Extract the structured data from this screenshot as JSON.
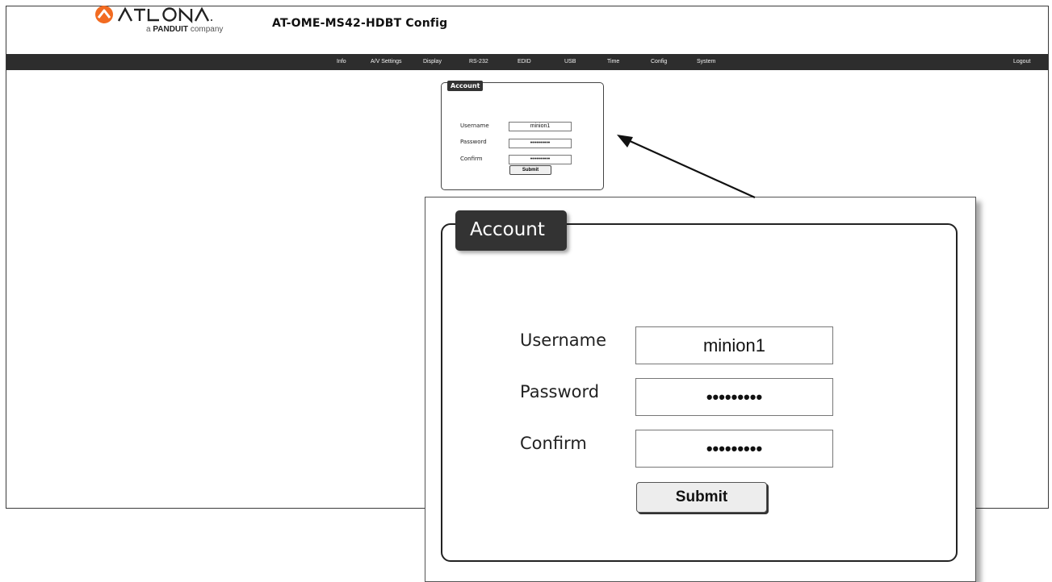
{
  "brand": {
    "name": "ATLONA",
    "tagline_prefix": "a",
    "tagline_brand": "PANDUIT",
    "tagline_suffix": "company",
    "accent_color": "#f26b21"
  },
  "header": {
    "title": "AT-OME-MS42-HDBT  Config"
  },
  "nav": {
    "items": [
      {
        "label": "Info"
      },
      {
        "label": "A/V Settings"
      },
      {
        "label": "Display"
      },
      {
        "label": "RS-232"
      },
      {
        "label": "EDID"
      },
      {
        "label": "USB"
      },
      {
        "label": "Time"
      },
      {
        "label": "Config"
      },
      {
        "label": "System"
      }
    ],
    "logout": "Logout"
  },
  "account": {
    "legend": "Account",
    "username_label": "Username",
    "username_value": "minion1",
    "password_label": "Password",
    "password_value": "••••••••••",
    "confirm_label": "Confirm",
    "confirm_value": "••••••••••",
    "submit_label": "Submit"
  },
  "zoom": {
    "legend": "Account",
    "username_label": "Username",
    "username_value": "minion1",
    "password_label": "Password",
    "password_value": "•••••••••",
    "confirm_label": "Confirm",
    "confirm_value": "•••••••••",
    "submit_label": "Submit"
  }
}
